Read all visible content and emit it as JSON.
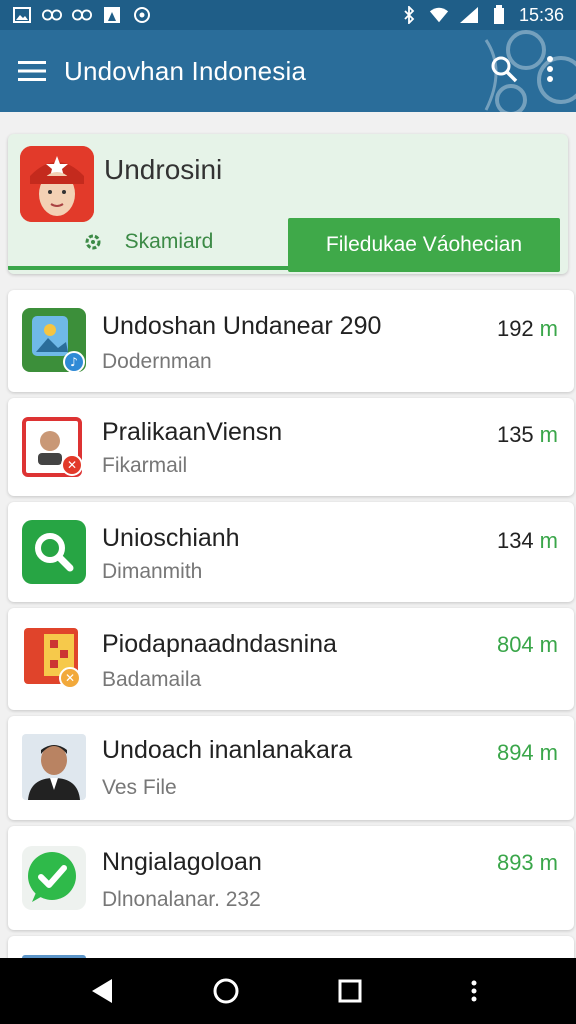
{
  "statusbar": {
    "time": "15:36"
  },
  "appbar": {
    "title": "Undovhan Indonesia"
  },
  "profile": {
    "name": "Undrosini"
  },
  "tabs": [
    {
      "label": "Skamiard"
    },
    {
      "label": "Filedukae Váohecian"
    }
  ],
  "items": [
    {
      "title": "Undoshan Undanear 290",
      "subtitle": "Dodernman",
      "value": "192",
      "unit": "m"
    },
    {
      "title": "PralikaanViensn",
      "subtitle": "Fikarmail",
      "value": "135",
      "unit": "m"
    },
    {
      "title": "Unioschianh",
      "subtitle": "Dimanmith",
      "value": "134",
      "unit": "m"
    },
    {
      "title": "Piodapnaadndasnina",
      "subtitle": "Badamaila",
      "value": "804",
      "unit": "m"
    },
    {
      "title": "Undoach inanlanakara",
      "subtitle": "Ves File",
      "value": "894",
      "unit": "m"
    },
    {
      "title": "Nngialagoloan",
      "subtitle": "Dlnonalanar. 232",
      "value": "893",
      "unit": "m"
    }
  ],
  "colors": {
    "appbar": "#2a6d9a",
    "statusbar": "#1f5e88",
    "accent": "#3fa949",
    "profile_bg": "#e6f3e8"
  }
}
